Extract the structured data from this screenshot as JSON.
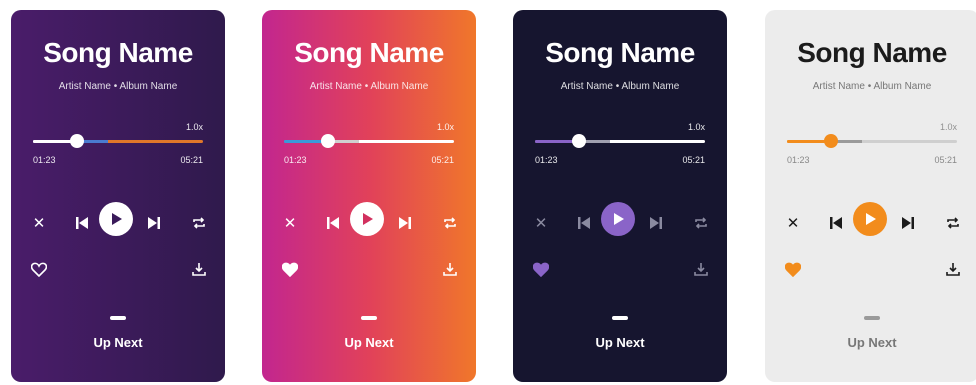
{
  "players": [
    {
      "song": "Song Name",
      "meta": "Artist Name • Album Name",
      "speed": "1.0x",
      "time_elapsed": "01:23",
      "time_total": "05:21",
      "progress": 0.26,
      "buffered": 0.44,
      "up_next": "Up Next",
      "colors": {
        "fill": "#ffffff",
        "buffer": "#4a7bd0",
        "rest": "#e0772a",
        "play_bg": "#ffffff",
        "play_icon": "#3a1a5a",
        "heart": "#ffffff",
        "heart_filled": false
      }
    },
    {
      "song": "Song Name",
      "meta": "Artist Name • Album Name",
      "speed": "1.0x",
      "time_elapsed": "01:23",
      "time_total": "05:21",
      "progress": 0.26,
      "buffered": 0.44,
      "up_next": "Up Next",
      "colors": {
        "fill": "#3a9ad9",
        "buffer": "#cfcfcf",
        "rest": "#ffffff",
        "play_bg": "#ffffff",
        "play_icon": "#d2305f",
        "heart": "#ffffff",
        "heart_filled": true
      }
    },
    {
      "song": "Song Name",
      "meta": "Artist Name • Album Name",
      "speed": "1.0x",
      "time_elapsed": "01:23",
      "time_total": "05:21",
      "progress": 0.26,
      "buffered": 0.44,
      "up_next": "Up Next",
      "colors": {
        "fill": "#8a64c8",
        "buffer": "#a0a0b0",
        "rest": "#ffffff",
        "play_bg": "#8a64c8",
        "play_icon": "#ffffff",
        "heart": "#8a64c8",
        "heart_filled": true
      }
    },
    {
      "song": "Song Name",
      "meta": "Artist Name • Album Name",
      "speed": "1.0x",
      "time_elapsed": "01:23",
      "time_total": "05:21",
      "progress": 0.26,
      "buffered": 0.44,
      "up_next": "Up Next",
      "colors": {
        "fill": "#f28c1c",
        "buffer": "#9a9a9a",
        "rest": "#cfcfcf",
        "play_bg": "#f28c1c",
        "play_icon": "#ffffff",
        "heart": "#f28c1c",
        "heart_filled": true
      }
    }
  ]
}
